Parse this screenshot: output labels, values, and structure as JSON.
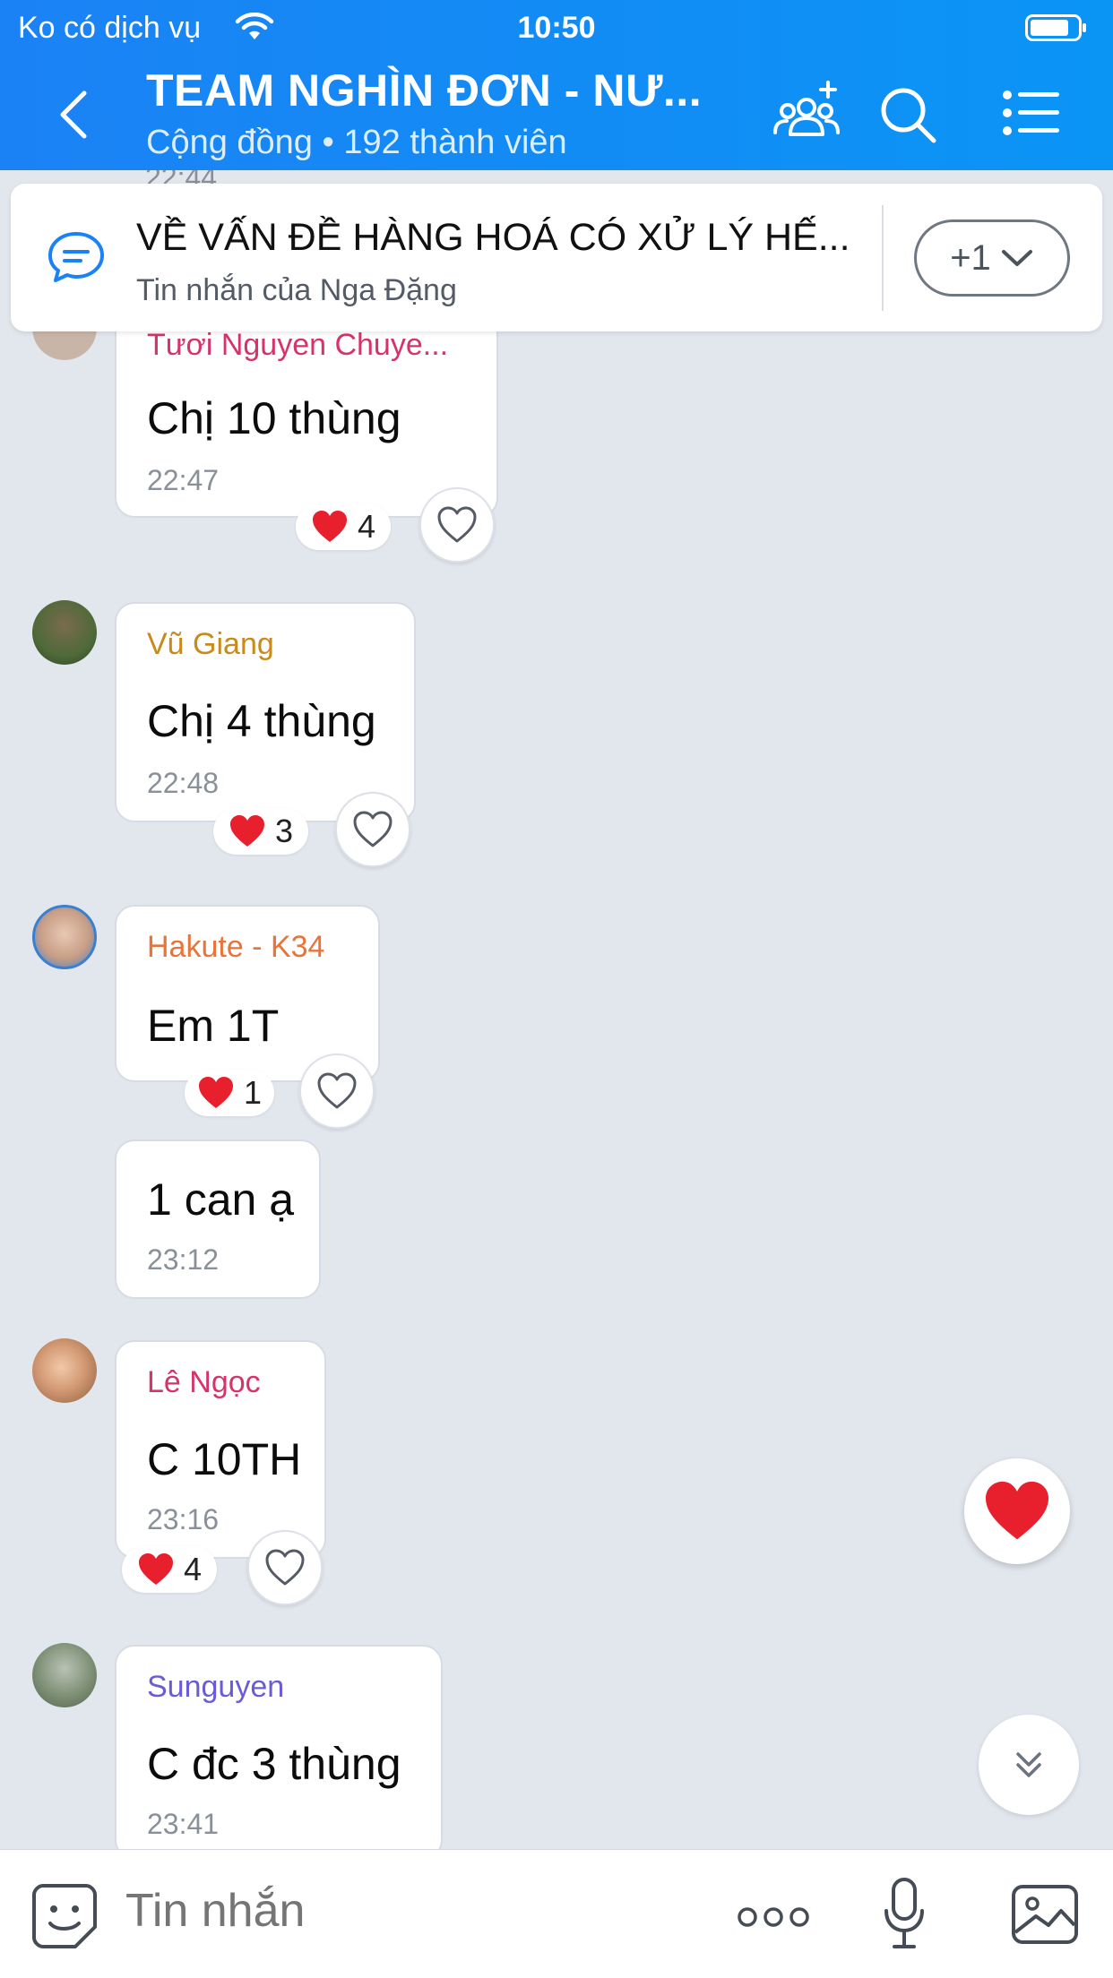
{
  "status_bar": {
    "carrier": "Ko có dịch vụ",
    "time": "10:50"
  },
  "header": {
    "title": "TEAM NGHÌN ĐƠN - NƯ...",
    "subtitle": "Cộng đồng • 192 thành viên"
  },
  "pinned": {
    "title": "VỀ VẤN ĐỀ HÀNG HOÁ CÓ XỬ LÝ HẾ...",
    "subtitle": "Tin nhắn của Nga Đặng",
    "count_label": "+1"
  },
  "partial_time_above": "22:44",
  "messages": [
    {
      "sender": "Tươi Nguyen Chuye...",
      "text": "Chị 10 thùng",
      "time": "22:47",
      "reaction_count": "4",
      "sender_color": "#d6336c"
    },
    {
      "sender": "Vũ Giang",
      "text": "Chị 4 thùng",
      "time": "22:48",
      "reaction_count": "3",
      "sender_color": "#c98a1a"
    },
    {
      "sender": "Hakute - K34",
      "text": "Em 1T",
      "time": "",
      "reaction_count": "1",
      "sender_color": "#e8743a"
    },
    {
      "sender": "",
      "text": "1 can ạ",
      "time": "23:12",
      "reaction_count": ""
    },
    {
      "sender": "Lê Ngọc",
      "text": "C 10TH",
      "time": "23:16",
      "reaction_count": "4",
      "sender_color": "#d6336c"
    },
    {
      "sender": "Sunguyen",
      "text": "C đc 3 thùng",
      "time": "23:41",
      "reaction_count": "",
      "sender_color": "#6a5bd6"
    }
  ],
  "input": {
    "placeholder": "Tin nhắn"
  },
  "colors": {
    "header_blue": "#1b82f5",
    "heart_red": "#e8202e",
    "background": "#e2e7ee"
  }
}
